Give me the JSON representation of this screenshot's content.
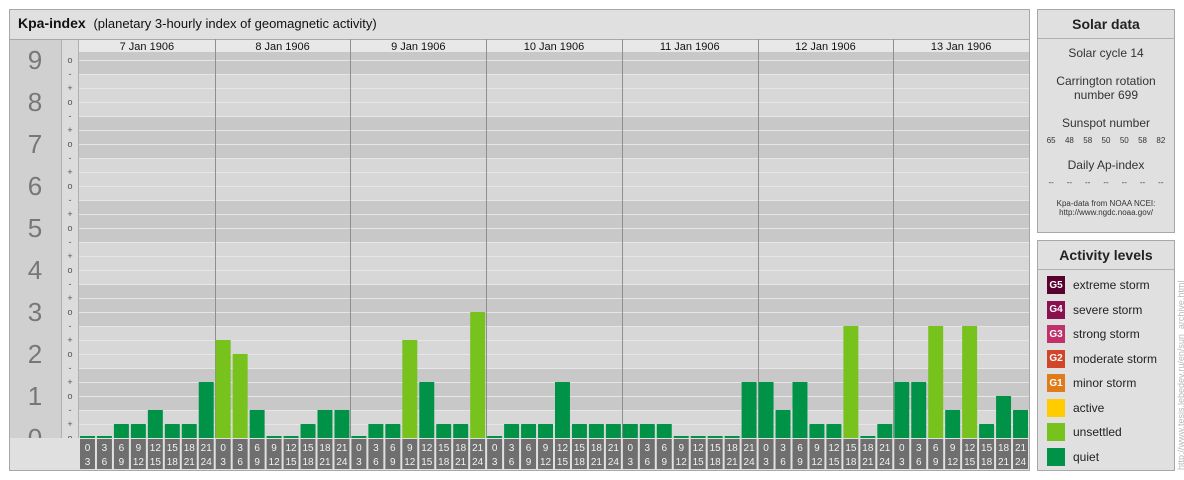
{
  "header": {
    "title": "Kpa-index",
    "subtitle": "(planetary 3-hourly index of geomagnetic activity)"
  },
  "chart_data": {
    "type": "bar",
    "title": "Kpa-index",
    "subtitle": "(planetary 3-hourly index of geomagnetic activity)",
    "ylim": [
      0,
      9
    ],
    "y_tick_labels": [
      "0",
      "1",
      "2",
      "3",
      "4",
      "5",
      "6",
      "7",
      "8",
      "9"
    ],
    "y_subtick_labels": [
      "o",
      "+",
      "-",
      "o",
      "+",
      "-",
      "o",
      "+",
      "-",
      "o",
      "+",
      "-",
      "o",
      "+",
      "-",
      "o",
      "+",
      "-",
      "o",
      "+",
      "-",
      "o",
      "+",
      "-",
      "o",
      "+",
      "-",
      "o"
    ],
    "days": [
      "7 Jan 1906",
      "8 Jan 1906",
      "9 Jan 1906",
      "10 Jan 1906",
      "11 Jan 1906",
      "12 Jan 1906",
      "13 Jan 1906"
    ],
    "interval_labels": [
      [
        "0",
        "3"
      ],
      [
        "3",
        "6"
      ],
      [
        "6",
        "9"
      ],
      [
        "9",
        "12"
      ],
      [
        "12",
        "15"
      ],
      [
        "15",
        "18"
      ],
      [
        "18",
        "21"
      ],
      [
        "21",
        "24"
      ]
    ],
    "values": [
      [
        0,
        0,
        0.333,
        0.333,
        0.667,
        0.333,
        0.333,
        1.333
      ],
      [
        2.333,
        2,
        0.667,
        0,
        0,
        0.333,
        0.667,
        0.667
      ],
      [
        0,
        0.333,
        0.333,
        2.333,
        1.333,
        0.333,
        0.333,
        3
      ],
      [
        0,
        0.333,
        0.333,
        0.333,
        1.333,
        0.333,
        0.333,
        0.333
      ],
      [
        0.333,
        0.333,
        0.333,
        0,
        0,
        0,
        0,
        1.333
      ],
      [
        1.333,
        0.667,
        1.333,
        0.333,
        0.333,
        2.667,
        0,
        0.333
      ],
      [
        1.333,
        1.333,
        2.667,
        0.667,
        2.667,
        0.333,
        1,
        0.667
      ]
    ],
    "colors": {
      "quiet": "#009246",
      "unsettled": "#77c21c",
      "active": "#ffcc00",
      "minor": "#e07b1a",
      "moderate": "#d2452a",
      "strong": "#c0306a",
      "severe": "#8a1050",
      "extreme": "#5a0030"
    }
  },
  "solar": {
    "title": "Solar data",
    "cycle": "Solar cycle 14",
    "carrington_line1": "Carrington rotation",
    "carrington_line2": "number 699",
    "sunspot_label": "Sunspot number",
    "sunspots": [
      "65",
      "48",
      "58",
      "50",
      "50",
      "58",
      "82"
    ],
    "ap_label": "Daily Ap-index",
    "ap_values": [
      "--",
      "--",
      "--",
      "--",
      "--",
      "--",
      "--"
    ],
    "source_line1": "Kpa-data from NOAA NCEI:",
    "source_line2": "http://www.ngdc.noaa.gov/"
  },
  "activity": {
    "title": "Activity levels",
    "levels": [
      {
        "badge": "G5",
        "label": "extreme storm",
        "color": "#5a0030"
      },
      {
        "badge": "G4",
        "label": "severe storm",
        "color": "#8a1050"
      },
      {
        "badge": "G3",
        "label": "strong storm",
        "color": "#c0306a"
      },
      {
        "badge": "G2",
        "label": "moderate storm",
        "color": "#d2452a"
      },
      {
        "badge": "G1",
        "label": "minor storm",
        "color": "#e07b1a"
      },
      {
        "badge": "",
        "label": "active",
        "color": "#ffcc00"
      },
      {
        "badge": "",
        "label": "unsettled",
        "color": "#77c21c"
      },
      {
        "badge": "",
        "label": "quiet",
        "color": "#009246"
      }
    ]
  },
  "watermark": "http://www.tesis.lebedev.ru/en/sun_archive.html"
}
